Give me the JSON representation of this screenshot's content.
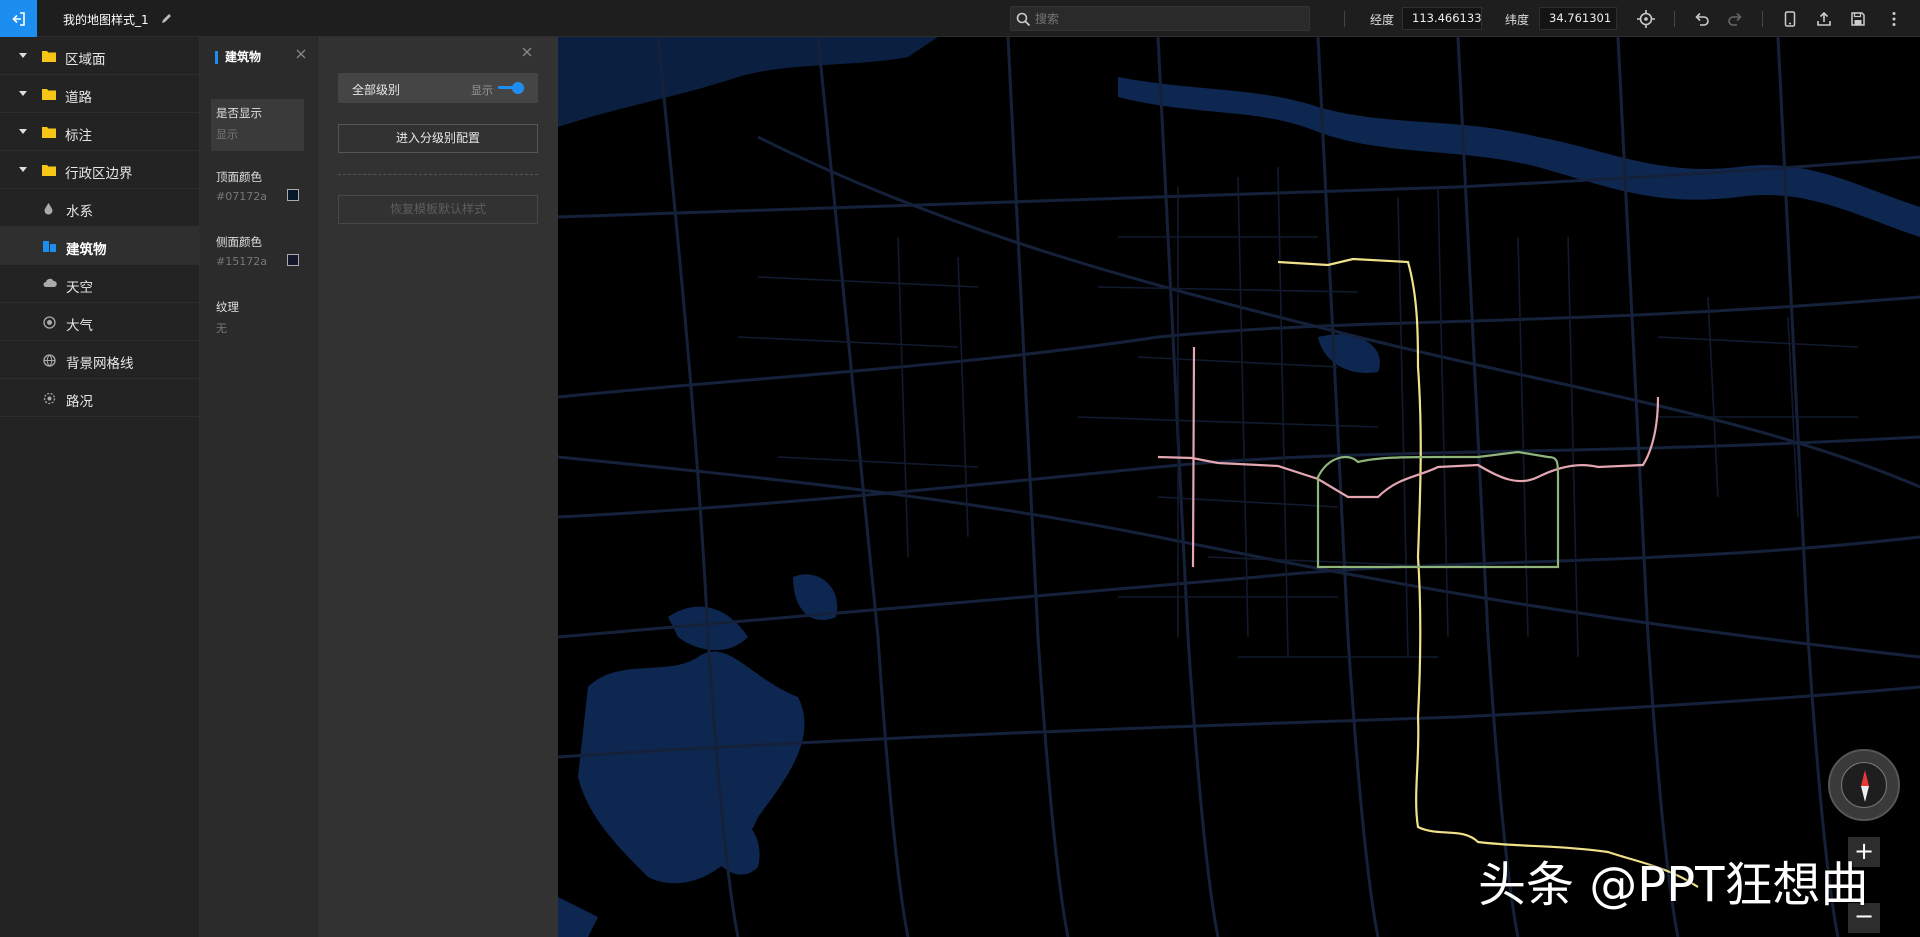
{
  "topbar": {
    "title": "我的地图样式_1",
    "search_placeholder": "搜索",
    "lng_label": "经度",
    "lng_value": "113.466133",
    "lat_label": "纬度",
    "lat_value": "34.761301",
    "accent_color": "#1c8ef0"
  },
  "tree": {
    "items": [
      {
        "label": "区域面",
        "icon": "folder-icon"
      },
      {
        "label": "道路",
        "icon": "folder-icon"
      },
      {
        "label": "标注",
        "icon": "folder-icon"
      },
      {
        "label": "行政区边界",
        "icon": "folder-icon"
      },
      {
        "label": "水系",
        "icon": "water-drop-icon"
      },
      {
        "label": "建筑物",
        "icon": "building-icon"
      },
      {
        "label": "天空",
        "icon": "cloud-icon"
      },
      {
        "label": "大气",
        "icon": "atmosphere-icon"
      },
      {
        "label": "背景网格线",
        "icon": "globe-grid-icon"
      },
      {
        "label": "路况",
        "icon": "traffic-icon"
      }
    ]
  },
  "props": {
    "title": "建筑物",
    "visible_label": "是否显示",
    "visible_value": "显示",
    "top_color_label": "顶面颜色",
    "top_color_value": "#07172a",
    "side_color_label": "侧面颜色",
    "side_color_value": "#15172a",
    "texture_label": "纹理",
    "texture_value": "无"
  },
  "levels": {
    "all_levels_label": "全部级别",
    "show_label": "显示",
    "enter_button": "进入分级别配置",
    "restore_button": "恢复模板默认样式"
  },
  "map": {
    "zoom_in": "+",
    "zoom_out": "−",
    "watermark": "头条 @PPT狂想曲",
    "road_color": "#15213a",
    "water_color": "#0e2750"
  }
}
